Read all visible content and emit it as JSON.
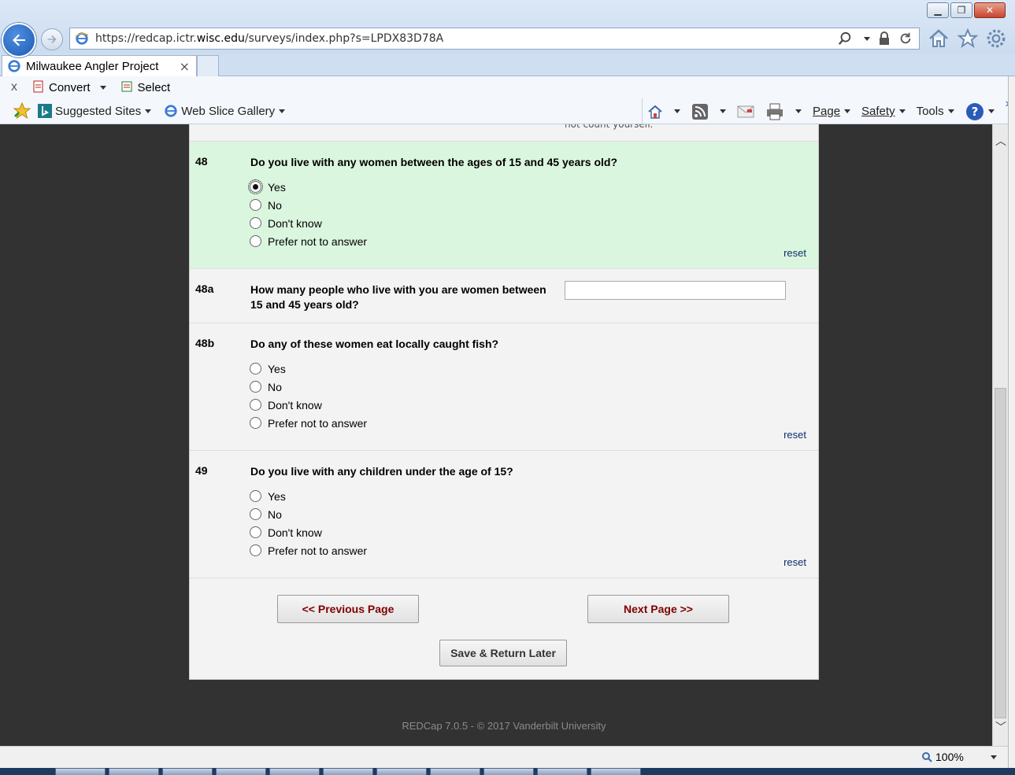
{
  "browser": {
    "url_prefix": "https://redcap.ictr.",
    "url_domain": "wisc.edu",
    "url_suffix": "/surveys/index.php?s=LPDX83D78A",
    "tab_title": "Milwaukee Angler Project",
    "tab_close": "×",
    "cmd_close": "x",
    "convert_label": "Convert",
    "select_label": "Select",
    "suggested_sites": "Suggested Sites",
    "web_slice_gallery": "Web Slice Gallery",
    "page_menu": "Page",
    "safety_menu": "Safety",
    "tools_menu": "Tools",
    "more": "»",
    "zoom_level": "100%"
  },
  "survey": {
    "prev_tail": "not count yourself.",
    "questions": [
      {
        "num": "48",
        "text": "Do you live with any women between the ages of 15 and 45 years old?",
        "options": [
          "Yes",
          "No",
          "Don't know",
          "Prefer not to answer"
        ],
        "selected": "Yes",
        "reset": "reset"
      },
      {
        "num": "48a",
        "text": "How many people who live with you are women between 15 and 45 years old?",
        "value": ""
      },
      {
        "num": "48b",
        "text": "Do any of these women eat locally caught fish?",
        "options": [
          "Yes",
          "No",
          "Don't know",
          "Prefer not to answer"
        ],
        "reset": "reset"
      },
      {
        "num": "49",
        "text": "Do you live with any children under the age of 15?",
        "options": [
          "Yes",
          "No",
          "Don't know",
          "Prefer not to answer"
        ],
        "reset": "reset"
      }
    ],
    "prev_button": "<< Previous Page",
    "next_button": "Next Page >>",
    "save_button": "Save & Return Later",
    "footer": "REDCap 7.0.5 - © 2017 Vanderbilt University"
  },
  "colors": {
    "active_question_bg": "#dbf6df",
    "nav_button_text": "#800000",
    "page_bg": "#323232"
  }
}
